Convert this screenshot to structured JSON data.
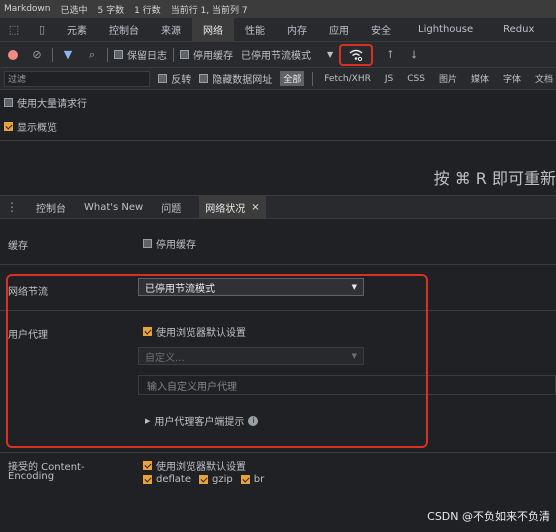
{
  "status_bar": {
    "app": "Markdown",
    "selected": "已选中",
    "chars": "5 字数",
    "lines": "1 行数",
    "cursor": "当前行 1, 当前列 7"
  },
  "devtools_tabs": [
    {
      "label": "元素",
      "active": false
    },
    {
      "label": "控制台",
      "active": false
    },
    {
      "label": "来源",
      "active": false
    },
    {
      "label": "网络",
      "active": true
    },
    {
      "label": "性能",
      "active": false
    },
    {
      "label": "内存",
      "active": false
    },
    {
      "label": "应用",
      "active": false
    },
    {
      "label": "安全",
      "active": false
    },
    {
      "label": "Lighthouse",
      "active": false
    },
    {
      "label": "Redux",
      "active": false
    }
  ],
  "toolbar": {
    "preserve_log": "保留日志",
    "disable_cache": "停用缓存",
    "throttle": "已停用节流模式",
    "icons": [
      "record-icon",
      "clear-icon",
      "filter-icon",
      "search-icon",
      "network-conditions-icon",
      "upload-icon",
      "download-icon"
    ]
  },
  "filter_bar": {
    "placeholder": "过滤",
    "invert": "反转",
    "hide_data_urls": "隐藏数据网址",
    "types": [
      {
        "label": "全部",
        "active": true
      },
      {
        "label": "Fetch/XHR",
        "active": false
      },
      {
        "label": "JS",
        "active": false
      },
      {
        "label": "CSS",
        "active": false
      },
      {
        "label": "图片",
        "active": false
      },
      {
        "label": "媒体",
        "active": false
      },
      {
        "label": "字体",
        "active": false
      },
      {
        "label": "文档",
        "active": false
      }
    ]
  },
  "options": {
    "large_rows": "使用大量请求行",
    "show_overview": "显示概览"
  },
  "reload_hint": "按 ⌘ R 即可重新",
  "drawer": {
    "tabs": [
      {
        "label": "控制台",
        "active": false
      },
      {
        "label": "What's New",
        "active": false
      },
      {
        "label": "问题",
        "active": false
      },
      {
        "label": "网络状况",
        "active": true
      }
    ],
    "close": "×"
  },
  "conditions": {
    "cache_label": "缓存",
    "cache_checkbox": "停用缓存",
    "throttling_label": "网络节流",
    "throttling_value": "已停用节流模式",
    "ua_label": "用户代理",
    "ua_default": "使用浏览器默认设置",
    "ua_custom": "自定义...",
    "ua_input_placeholder": "输入自定义用户代理",
    "ua_client_hints": "用户代理客户端提示",
    "encoding_label_1": "接受的 Content-",
    "encoding_label_2": "Encoding",
    "encoding_default": "使用浏览器默认设置",
    "encodings": [
      "deflate",
      "gzip",
      "br"
    ]
  },
  "watermark": "CSDN @不负如来不负清",
  "colors": {
    "highlight_border": "#d93025",
    "checkbox_on": "#e8a33d",
    "background": "#202124"
  }
}
